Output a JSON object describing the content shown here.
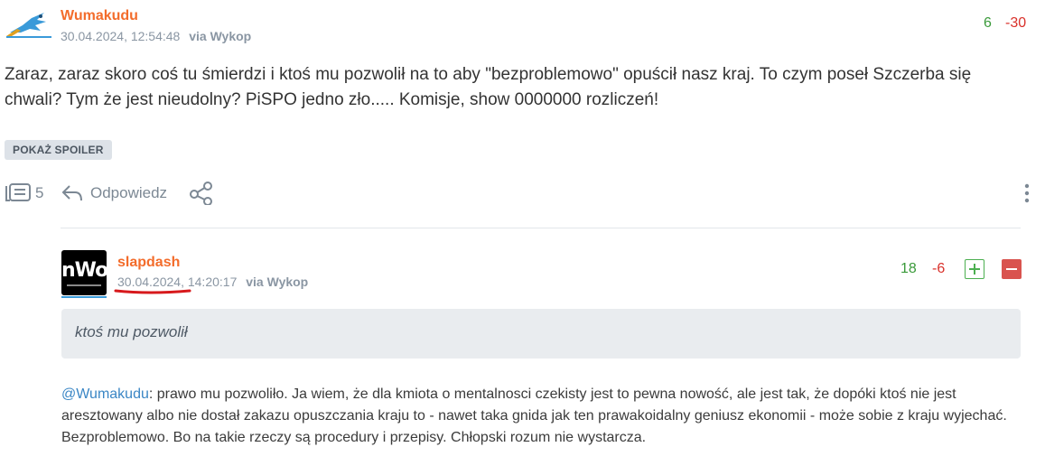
{
  "post": {
    "author": "Wumakudu",
    "date": "30.04.2024, 12:54:48",
    "via": "via Wykop",
    "votes_plus": "6",
    "votes_minus": "-30",
    "text": "Zaraz, zaraz skoro coś tu śmierdzi i ktoś mu pozwolił na to aby \"bezproblemowo\" opuścił nasz kraj. To czym poseł Szczerba się chwali? Tym że jest nieudolny? PiSPO jedno zło..... Komisje, show 0000000 rozliczeń!",
    "spoiler_label": "POKAŻ SPOILER",
    "comments_count": "5",
    "reply_label": "Odpowiedz"
  },
  "reply": {
    "avatar_text": "nWo",
    "author": "slapdash",
    "date": "30.04.2024",
    "time": ", 14:20:17",
    "via": "via Wykop",
    "votes_plus": "18",
    "votes_minus": "-6",
    "quote": "ktoś mu pozwolił",
    "mention": "@Wumakudu",
    "text": ": prawo mu pozwoliło. Ja wiem, że dla kmiota o mentalnosci czekisty jest to pewna nowość, ale jest tak, że dopóki ktoś nie jest aresztowany albo nie dostał zakazu opuszczania kraju to - nawet taka gnida jak ten prawakoidalny geniusz ekonomii - może sobie z kraju wyjechać. Bezproblemowo. Bo na takie rzeczy są procedury i przepisy. Chłopski rozum nie wystarcza."
  },
  "colors": {
    "author": "#f36c2b",
    "plus": "#3a9a3a",
    "minus": "#d9312b",
    "mention": "#3a86c5",
    "underline_annotation": "#d7191c"
  }
}
